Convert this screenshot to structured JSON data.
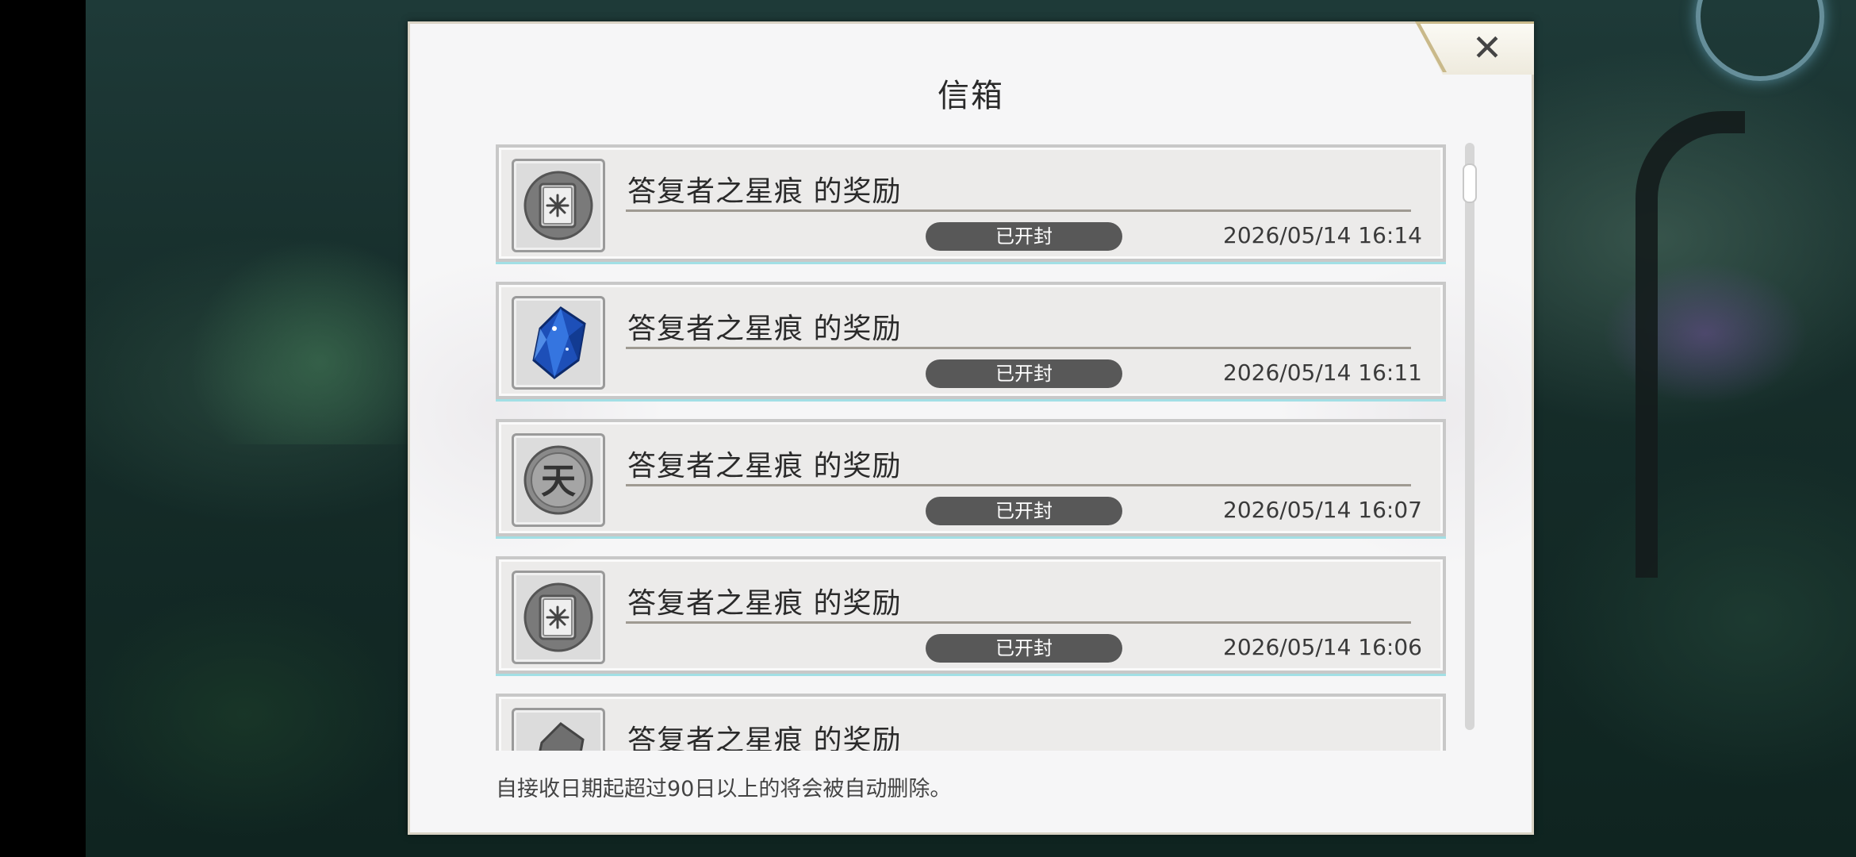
{
  "dialog": {
    "title": "信箱",
    "footer_note": "自接收日期起超过90日以上的将会被自动删除。"
  },
  "mail_items": [
    {
      "title": "答复者之星痕 的奖励",
      "status": "已开封",
      "time": "2026/05/14 16:14",
      "icon": "book-icon"
    },
    {
      "title": "答复者之星痕 的奖励",
      "status": "已开封",
      "time": "2026/05/14 16:11",
      "icon": "blue-crystal-icon"
    },
    {
      "title": "答复者之星痕 的奖励",
      "status": "已开封",
      "time": "2026/05/14 16:07",
      "icon": "tian-coin-icon"
    },
    {
      "title": "答复者之星痕 的奖励",
      "status": "已开封",
      "time": "2026/05/14 16:06",
      "icon": "book-icon"
    },
    {
      "title": "答复者之星痕 的奖励",
      "status": "",
      "time": "",
      "icon": "crystal-icon"
    }
  ],
  "tian_coin_glyph": "天"
}
